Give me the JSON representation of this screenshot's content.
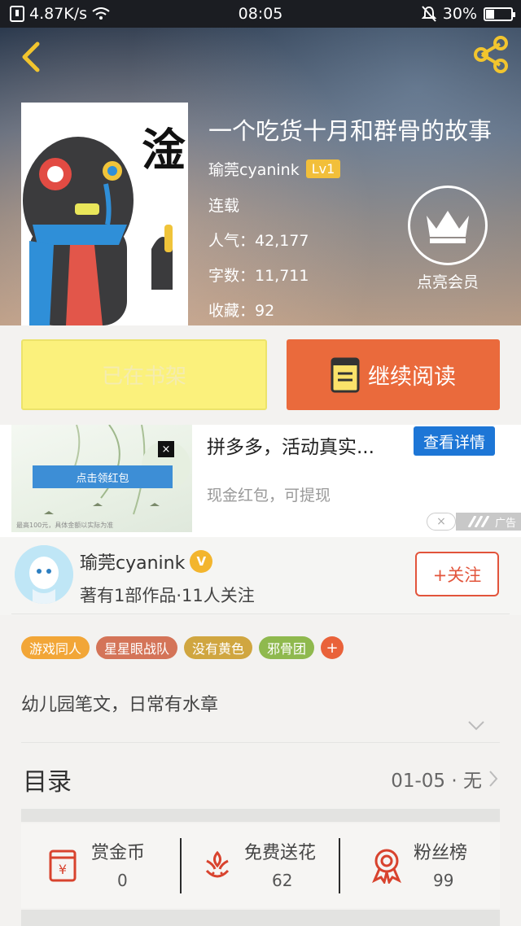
{
  "status_bar": {
    "speed": "4.87K/s",
    "time": "08:05",
    "battery": "30%"
  },
  "book": {
    "title": "一个吃货十月和群骨的故事",
    "author": "瑜莞cyanink",
    "level": "Lv1",
    "status": "连载",
    "popularity": "人气：42,177",
    "word_count": "字数：11,711",
    "favorites": "收藏：92",
    "cover_text": "淦"
  },
  "vip": {
    "label": "点亮会员"
  },
  "actions": {
    "shelf_label": "已在书架",
    "read_label": "继续阅读"
  },
  "ad": {
    "title": "拼多多，活动真实...",
    "detail_button": "查看详情",
    "subtitle": "现金红包，可提现",
    "redpacket": "点击领红包",
    "close": "×",
    "tag": "广告",
    "fine_print": "最高100元，具体金额以实际为准"
  },
  "author_card": {
    "name": "瑜莞cyanink",
    "badge": "V",
    "sub": "著有1部作品·11人关注",
    "follow_label": "+关注"
  },
  "tags": [
    {
      "label": "游戏同人",
      "color": "#f2a637"
    },
    {
      "label": "星星眼战队",
      "color": "#d47458"
    },
    {
      "label": "没有黄色",
      "color": "#d0a640"
    },
    {
      "label": "邪骨团",
      "color": "#8fb94e"
    }
  ],
  "tag_add": "+",
  "description": "幼儿园笔文，日常有水章",
  "toc": {
    "label": "目录",
    "latest": "01-05 · 无"
  },
  "stats": [
    {
      "label": "赏金币",
      "value": "0",
      "icon": "red-envelope-icon"
    },
    {
      "label": "免费送花",
      "value": "62",
      "icon": "flower-icon"
    },
    {
      "label": "粉丝榜",
      "value": "99",
      "icon": "award-ribbon-icon"
    }
  ],
  "colors": {
    "accent": "#ea6a3c",
    "shelf_yellow": "#fbf17c",
    "ad_blue": "#1d76d6",
    "icon_red": "#d8432e"
  }
}
